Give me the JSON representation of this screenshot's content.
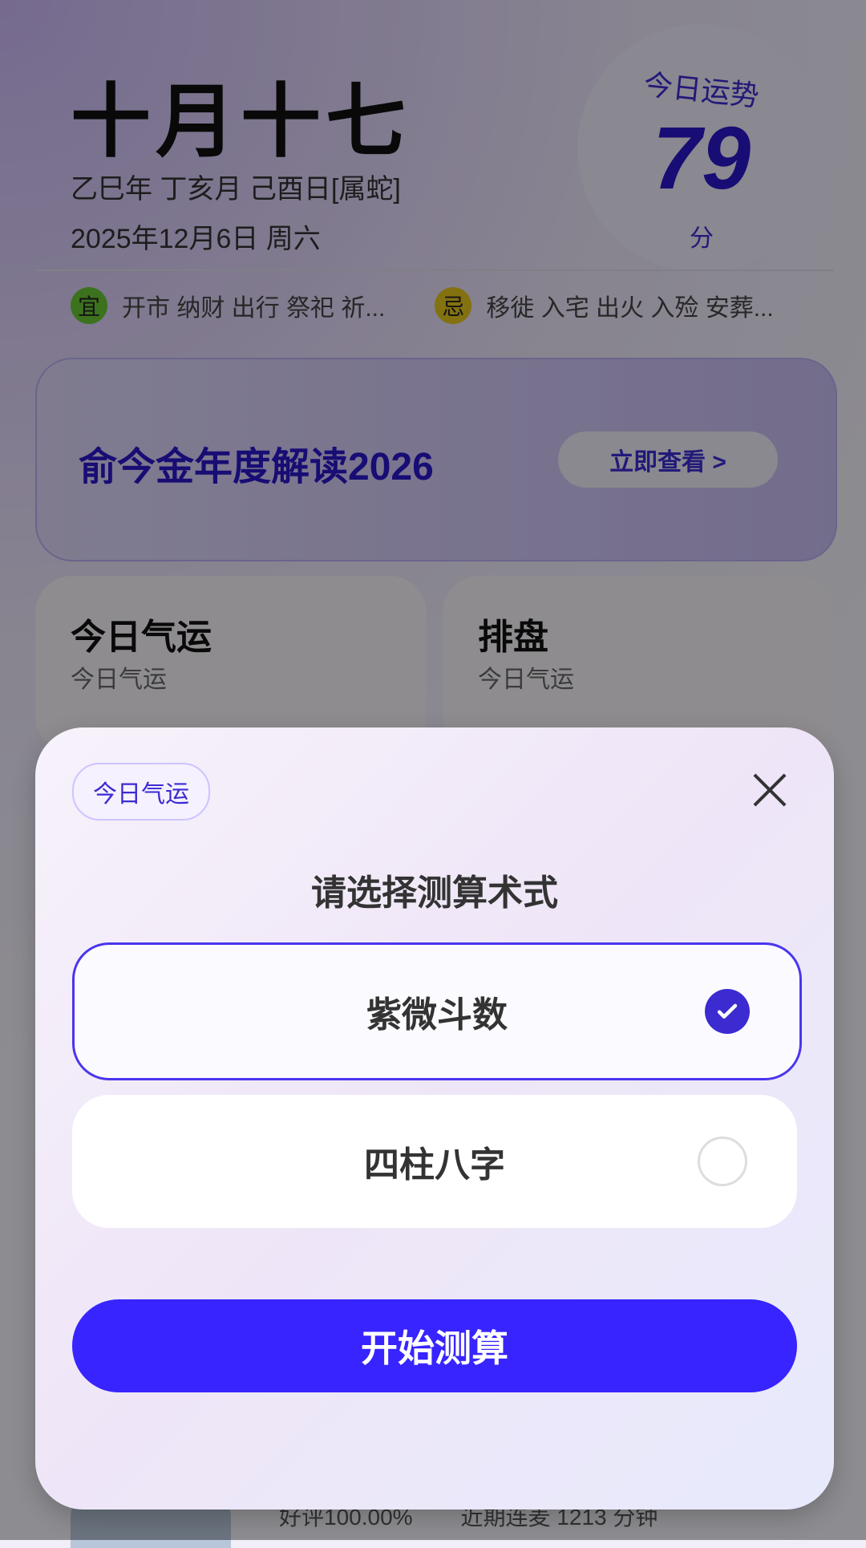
{
  "header": {
    "lunar_date": "十月十七",
    "ganzhi": "乙巳年 丁亥月 己酉日[属蛇]",
    "solar_date": "2025年12月6日 周六",
    "fortune": {
      "label": "今日运势",
      "score": "79",
      "unit": "分"
    },
    "yi": {
      "badge": "宜",
      "items": "开市 纳财 出行 祭祀 祈..."
    },
    "ji": {
      "badge": "忌",
      "items": "移徙 入宅 出火 入殓 安葬..."
    }
  },
  "promo": {
    "title": "俞今金年度解读2026",
    "button": "立即查看 >"
  },
  "cards": [
    {
      "title": "今日气运",
      "subtitle": "今日气运"
    },
    {
      "title": "排盘",
      "subtitle": "今日气运"
    }
  ],
  "bottom_peek": {
    "rating": "好评100.00%",
    "recent": "近期连麦 1213 分钟"
  },
  "modal": {
    "tag": "今日气运",
    "title": "请选择测算术式",
    "options": [
      {
        "label": "紫微斗数",
        "selected": true
      },
      {
        "label": "四柱八字",
        "selected": false
      }
    ],
    "cta": "开始测算"
  },
  "colors": {
    "accent": "#3724FF",
    "accent_dark": "#2A17C8",
    "yi_badge": "#68C534",
    "ji_badge": "#E2C41B"
  }
}
